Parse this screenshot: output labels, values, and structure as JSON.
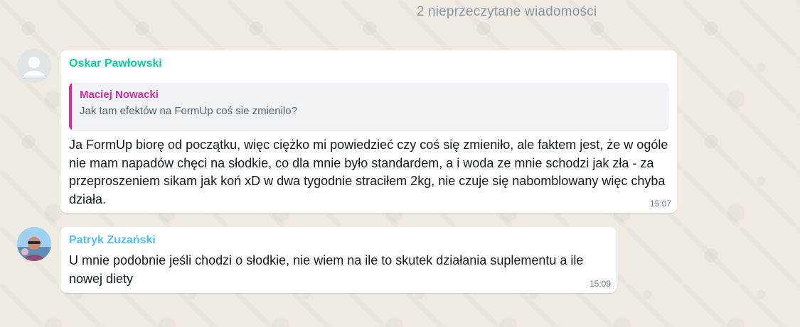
{
  "chat": {
    "unread_divider": "2 nieprzeczytane wiadomości",
    "messages": [
      {
        "sender": "Oskar Pawłowski",
        "avatar_icon": "default-user-avatar-icon",
        "quote": {
          "author": "Maciej Nowacki",
          "text": "Jak tam efektów na FormUp coś sie zmienilo?"
        },
        "text": "Ja FormUp biorę od początku, więc ciężko mi powiedzieć czy coś się zmieniło, ale faktem jest, że w ogóle nie mam napadów chęci na słodkie, co dla mnie było standardem, a i woda ze mnie schodzi jak zła - za przeproszeniem sikam jak koń xD w dwa tygodnie straciłem 2kg, nie czuje się nabomblowany więc chyba działa.",
        "time": "15:07"
      },
      {
        "sender": "Patryk Zuzański",
        "avatar_icon": "profile-photo-avatar",
        "text": "U mnie podobnie jeśli chodzi o słodkie, nie wiem na ile to skutek działania suplementu a ile nowej diety",
        "time": "15:09"
      }
    ]
  },
  "colors": {
    "background": "#efeae2",
    "bubble": "#ffffff",
    "sender_1": "#06cf9c",
    "sender_2": "#53bdeb",
    "quote_accent": "#d12fa4",
    "timestamp": "#667781",
    "divider_text": "#8696a0"
  }
}
